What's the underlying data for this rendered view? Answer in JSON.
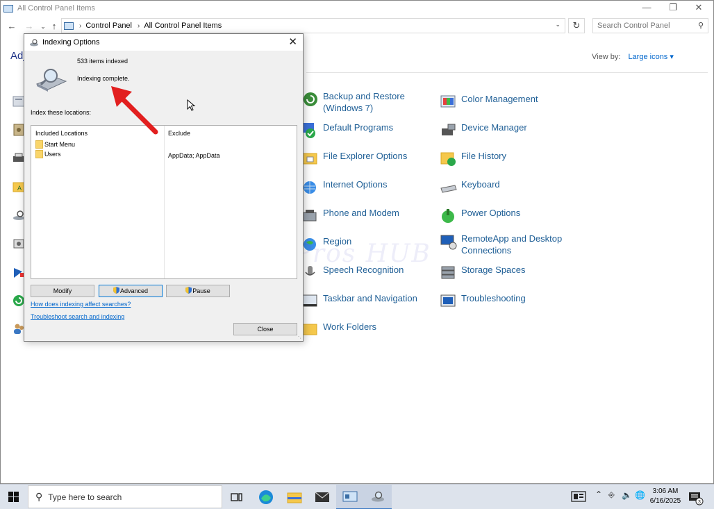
{
  "control_panel": {
    "window_title": "All Control Panel Items",
    "breadcrumb": [
      "Control Panel",
      "All Control Panel Items"
    ],
    "search_placeholder": "Search Control Panel",
    "adjust_label": "Adj",
    "view_by_label": "View by:",
    "view_by_value": "Large icons",
    "items": [
      {
        "label": "Backup and Restore (Windows 7)",
        "icon": "backup-restore-icon"
      },
      {
        "label": "Color Management",
        "icon": "color-management-icon"
      },
      {
        "label": "Default Programs",
        "icon": "default-programs-icon"
      },
      {
        "label": "Device Manager",
        "icon": "device-manager-icon"
      },
      {
        "label": "File Explorer Options",
        "icon": "file-explorer-options-icon"
      },
      {
        "label": "File History",
        "icon": "file-history-icon"
      },
      {
        "label": "Internet Options",
        "icon": "internet-options-icon"
      },
      {
        "label": "Keyboard",
        "icon": "keyboard-icon"
      },
      {
        "label": "Phone and Modem",
        "icon": "phone-modem-icon"
      },
      {
        "label": "Power Options",
        "icon": "power-options-icon"
      },
      {
        "label": "Region",
        "icon": "region-icon"
      },
      {
        "label": "RemoteApp and Desktop Connections",
        "icon": "remoteapp-icon"
      },
      {
        "label": "Speech Recognition",
        "icon": "speech-recognition-icon"
      },
      {
        "label": "Storage Spaces",
        "icon": "storage-spaces-icon"
      },
      {
        "label": "Taskbar and Navigation",
        "icon": "taskbar-navigation-icon"
      },
      {
        "label": "Troubleshooting",
        "icon": "troubleshooting-icon"
      },
      {
        "label": "Work Folders",
        "icon": "work-folders-icon"
      }
    ]
  },
  "indexing_dialog": {
    "title": "Indexing Options",
    "items_indexed": "533 items indexed",
    "status": "Indexing complete.",
    "locations_label": "Index these locations:",
    "columns": {
      "included": "Included Locations",
      "exclude": "Exclude"
    },
    "locations": [
      {
        "name": "Start Menu",
        "exclude": ""
      },
      {
        "name": "Users",
        "exclude": "AppData; AppData"
      }
    ],
    "buttons": {
      "modify": "Modify",
      "advanced": "Advanced",
      "pause": "Pause",
      "close": "Close"
    },
    "links": {
      "affect": "How does indexing affect searches?",
      "troubleshoot": "Troubleshoot search and indexing"
    }
  },
  "watermark": "IT Pros HUB",
  "taskbar": {
    "search_placeholder": "Type here to search",
    "time": "3:06 AM",
    "date": "6/16/2025",
    "notification_count": "3"
  },
  "colors": {
    "link": "#0066cc",
    "cp_item_text": "#1f5f96",
    "arrow": "#e21f1f",
    "taskbar": "#dde3ec"
  }
}
